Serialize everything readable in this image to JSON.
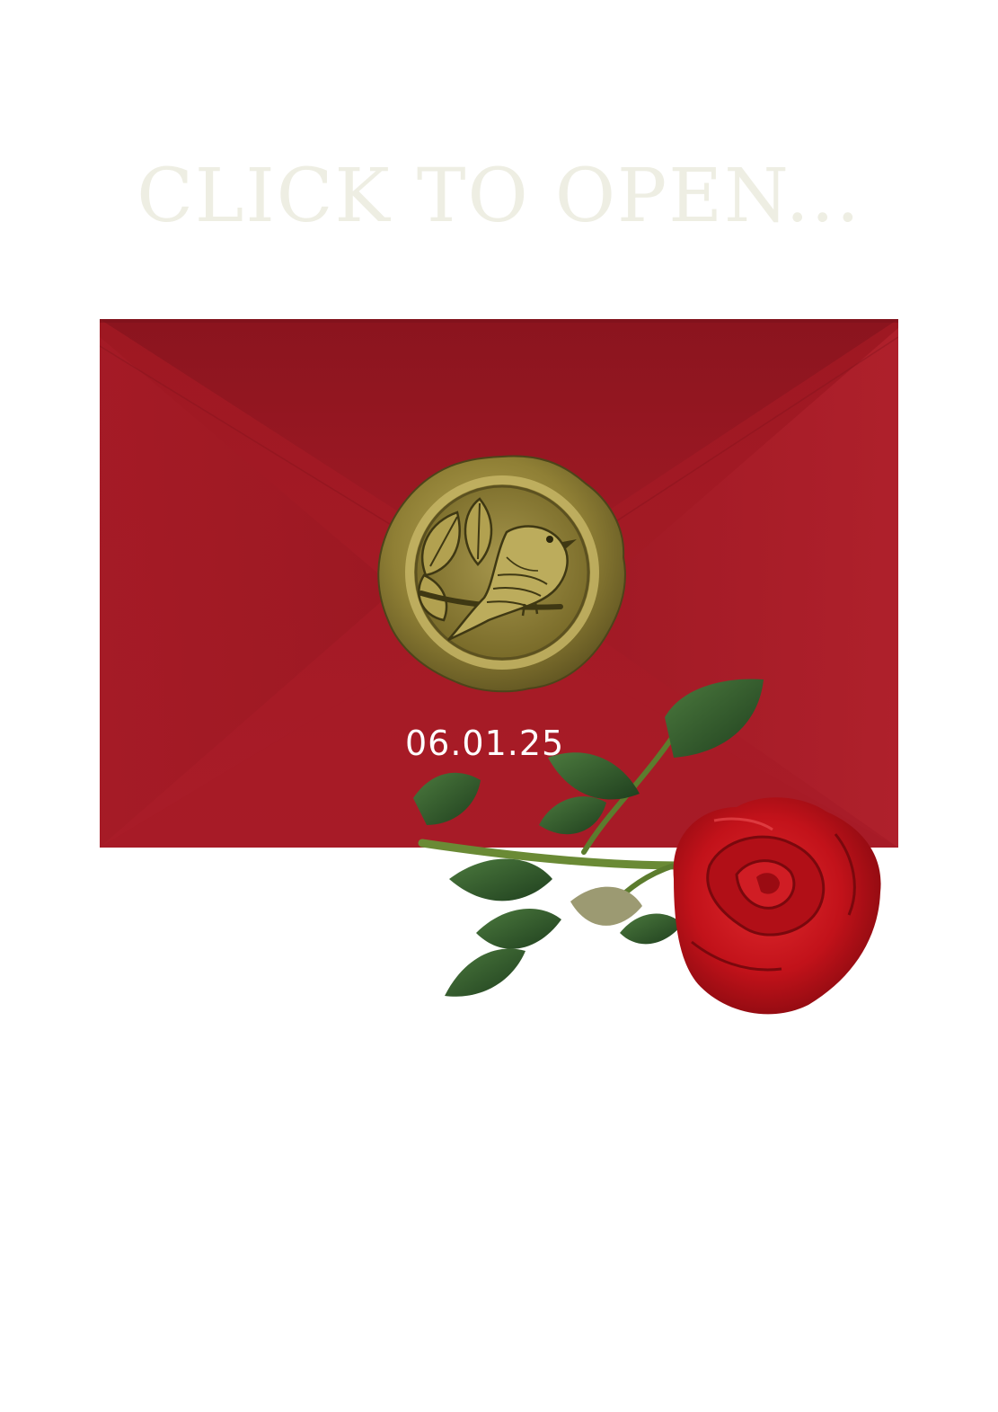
{
  "prompt": {
    "text": "CLICK TO OPEN..."
  },
  "envelope": {
    "date": "06.01.25"
  },
  "icons": {
    "seal": "wax-seal-bird-icon",
    "rose": "red-rose-icon"
  },
  "colors": {
    "prompt_text": "#eeeee3",
    "envelope_red": "#a81c27",
    "envelope_dark": "#8d1620",
    "seal_gold": "#9c8b3c",
    "date_text": "#ffffff",
    "rose_red": "#c8121a",
    "leaf_green": "#2f5a2c",
    "background": "#ffffff"
  }
}
